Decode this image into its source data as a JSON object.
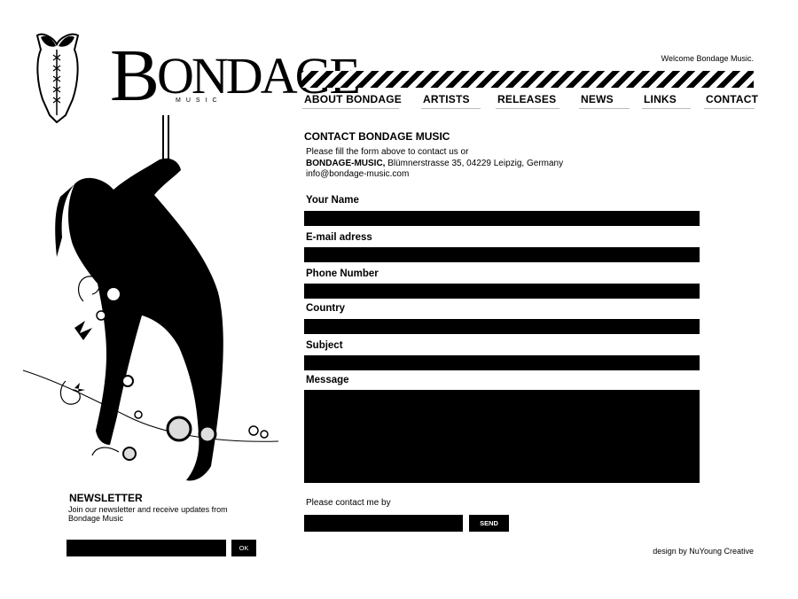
{
  "logo": {
    "wordmark_initial": "B",
    "wordmark_rest": "ONDAGE",
    "subtitle": "MUSIC"
  },
  "header": {
    "welcome": "Welcome Bondage Music."
  },
  "nav": {
    "items": [
      "ABOUT BONDAGE",
      "ARTISTS",
      "RELEASES",
      "NEWS",
      "LINKS",
      "CONTACT"
    ]
  },
  "contact": {
    "title": "CONTACT BONDAGE MUSIC",
    "intro": "Please fill the form above to contact us or",
    "company": "BONDAGE-MUSIC,",
    "address": " Blümnerstrasse 35, 04229 Leipzig, Germany",
    "email": "info@bondage-music.com"
  },
  "form": {
    "name_label": "Your Name",
    "email_label": "E-mail adress",
    "phone_label": "Phone Number",
    "country_label": "Country",
    "subject_label": "Subject",
    "message_label": "Message",
    "contact_by_label": "Please contact me by",
    "send_label": "SEND"
  },
  "newsletter": {
    "title": "NEWSLETTER",
    "text": "Join our newsletter and receive updates from Bondage Music",
    "ok_label": "OK"
  },
  "footer": {
    "credit": "design by NuYoung Creative"
  },
  "colors": {
    "background": "#ffffff",
    "foreground": "#000000",
    "accent_line": "#bbbbbb"
  }
}
